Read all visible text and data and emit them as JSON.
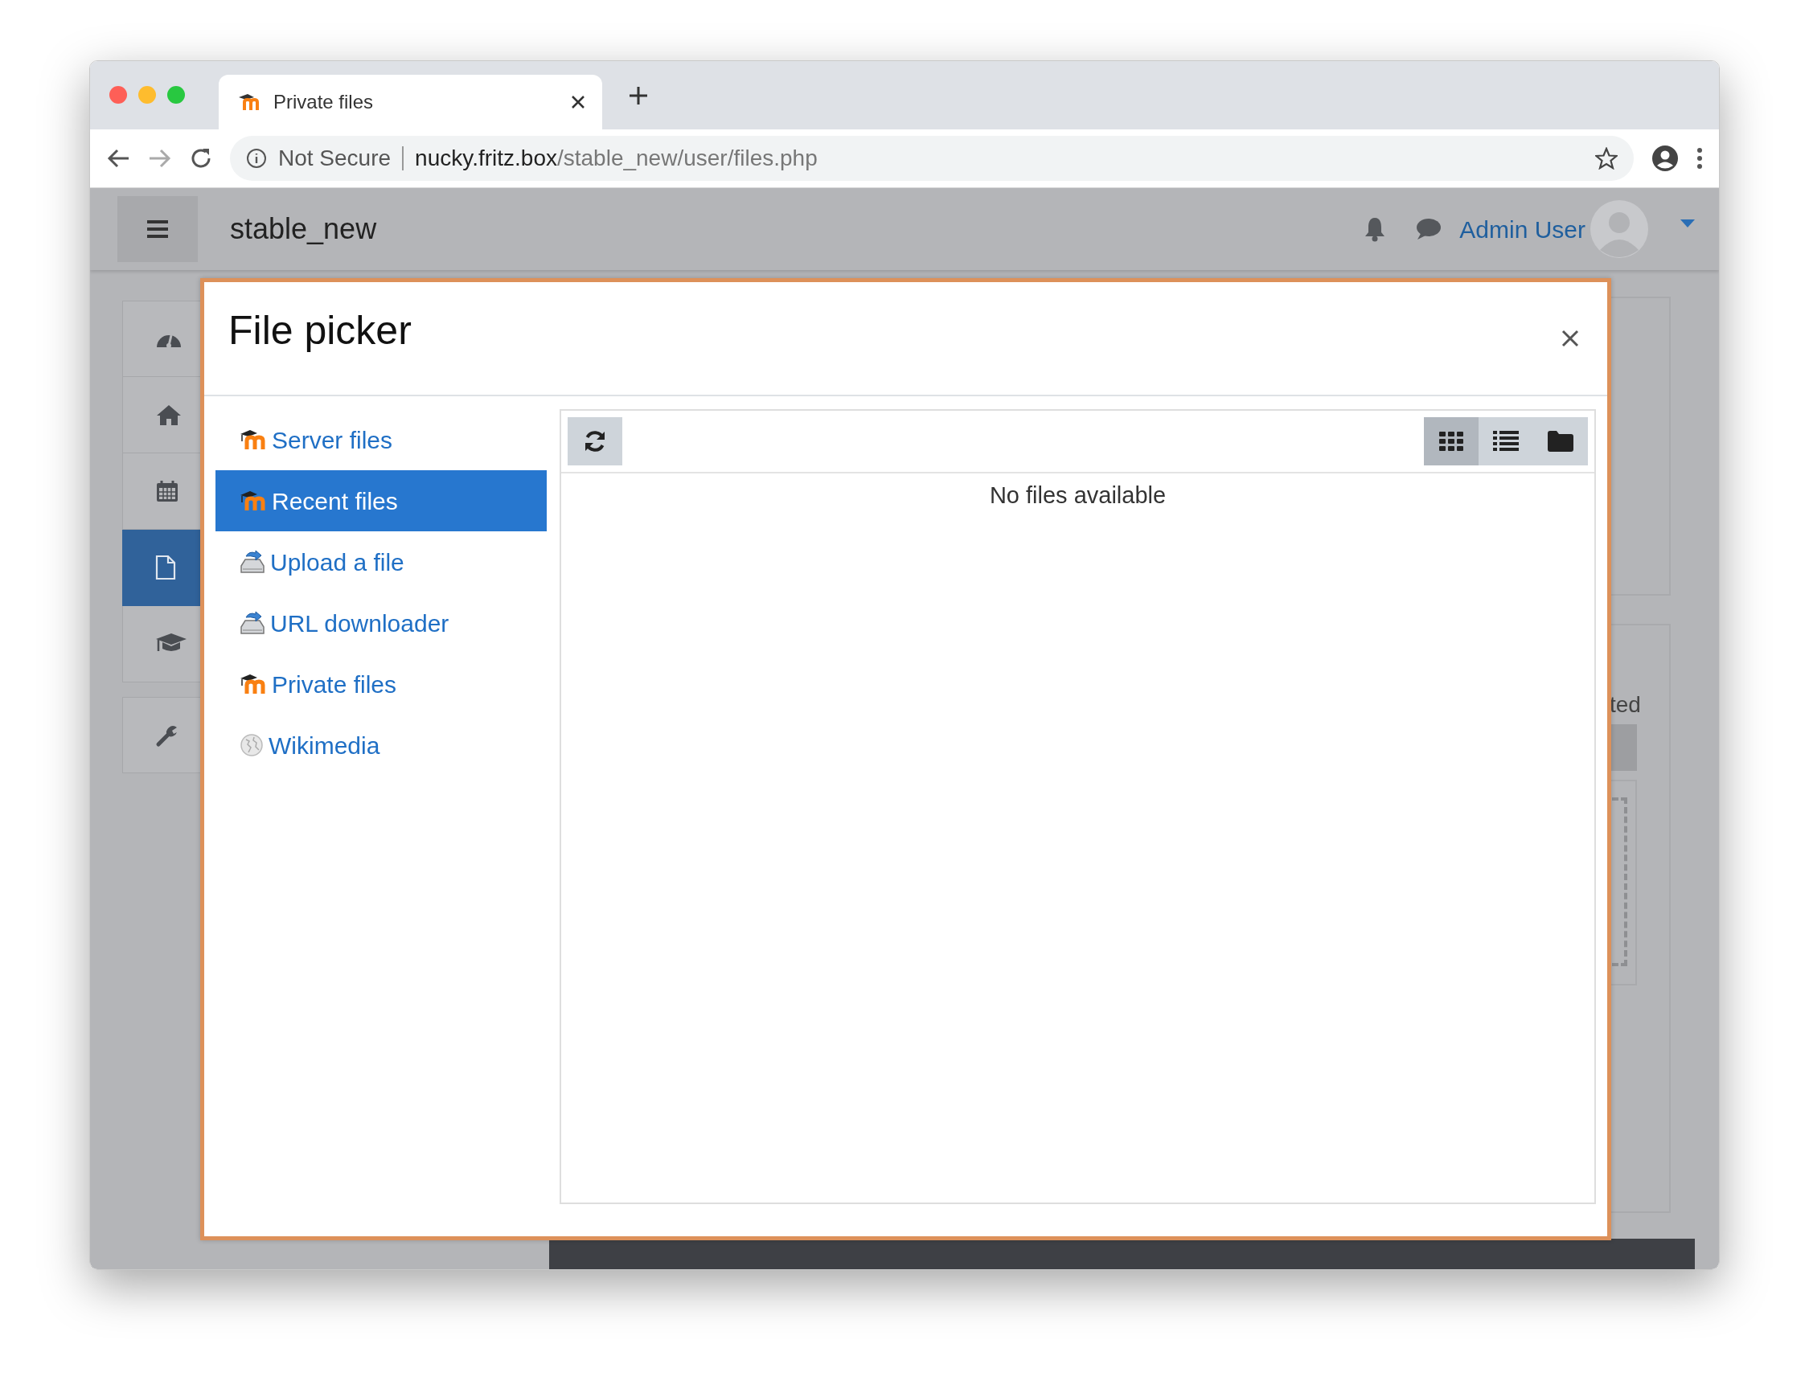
{
  "browser": {
    "tab": {
      "title": "Private files"
    },
    "address": {
      "security": "Not Secure",
      "host": "nucky.fritz.box",
      "path": "/stable_new/user/files.php"
    }
  },
  "site": {
    "name": "stable_new",
    "user": "Admin User"
  },
  "sidebar": {
    "items": [
      {
        "kind": "dashboard",
        "selected": false
      },
      {
        "kind": "home",
        "selected": false
      },
      {
        "kind": "calendar",
        "selected": false
      },
      {
        "kind": "file",
        "selected": true
      },
      {
        "kind": "cap",
        "selected": false
      },
      {
        "kind": "wrench",
        "selected": false
      }
    ]
  },
  "background": {
    "text": "ted"
  },
  "dialog": {
    "title": "File picker",
    "repositories": [
      {
        "label": "Server files",
        "kind": "moodle",
        "selected": false
      },
      {
        "label": "Recent files",
        "kind": "moodle",
        "selected": true
      },
      {
        "label": "Upload a file",
        "kind": "upload",
        "selected": false
      },
      {
        "label": "URL downloader",
        "kind": "upload",
        "selected": false
      },
      {
        "label": "Private files",
        "kind": "moodle",
        "selected": false
      },
      {
        "label": "Wikimedia",
        "kind": "globe",
        "selected": false
      }
    ],
    "views": [
      {
        "kind": "icons",
        "selected": true
      },
      {
        "kind": "list",
        "selected": false
      },
      {
        "kind": "tree",
        "selected": false
      }
    ],
    "message": "No files available"
  }
}
